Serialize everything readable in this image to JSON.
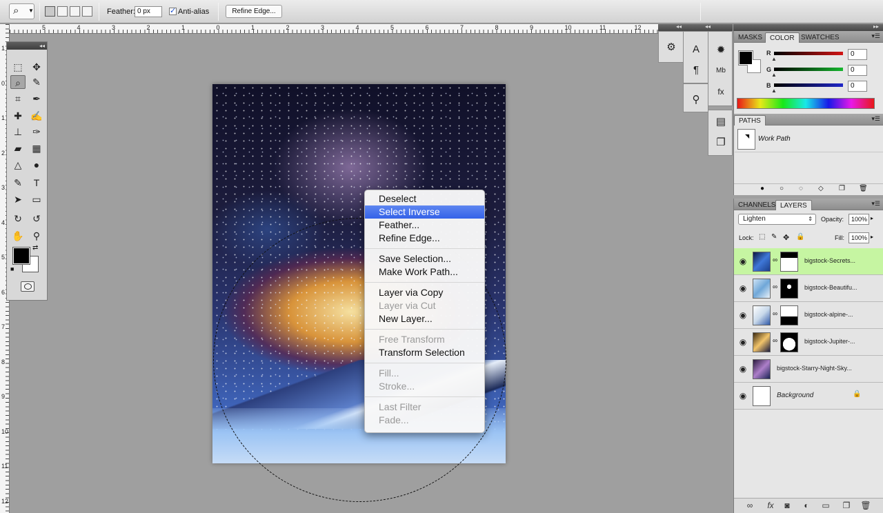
{
  "options_bar": {
    "tool_icon": "lasso-icon",
    "feather_label": "Feather:",
    "feather_value": "0 px",
    "anti_alias_label": "Anti-alias",
    "anti_alias_checked": true,
    "refine_edge_button": "Refine Edge..."
  },
  "ruler": {
    "horizontal": [
      "5",
      "4",
      "3",
      "2",
      "1",
      "0",
      "1",
      "2",
      "3",
      "4",
      "5",
      "6",
      "7",
      "8",
      "9",
      "10",
      "11",
      "12"
    ],
    "vertical": [
      "1",
      "0",
      "1",
      "2",
      "3",
      "4",
      "5",
      "6",
      "7",
      "8",
      "9",
      "10",
      "11",
      "12"
    ]
  },
  "tools_panel": {
    "collapse_glyph": "◂◂",
    "tools": [
      "marquee-icon",
      "move-icon",
      "lasso-icon",
      "quick-selection-icon",
      "crop-icon",
      "eyedropper-icon",
      "healing-brush-icon",
      "brush-icon",
      "clone-stamp-icon",
      "history-brush-icon",
      "eraser-icon",
      "gradient-icon",
      "blur-icon",
      "dodge-icon",
      "pen-icon",
      "type-icon",
      "path-selection-icon",
      "rectangle-icon",
      "3d-rotate-icon",
      "3d-orbit-icon",
      "hand-icon",
      "zoom-icon"
    ],
    "quick_mask_icon": "quick-mask-icon"
  },
  "context_menu": {
    "items": [
      {
        "label": "Deselect",
        "enabled": true
      },
      {
        "label": "Select Inverse",
        "enabled": true,
        "highlighted": true
      },
      {
        "label": "Feather...",
        "enabled": true
      },
      {
        "label": "Refine Edge...",
        "enabled": true
      },
      {
        "sep": true
      },
      {
        "label": "Save Selection...",
        "enabled": true
      },
      {
        "label": "Make Work Path...",
        "enabled": true
      },
      {
        "sep": true
      },
      {
        "label": "Layer via Copy",
        "enabled": true
      },
      {
        "label": "Layer via Cut",
        "enabled": false
      },
      {
        "label": "New Layer...",
        "enabled": true
      },
      {
        "sep": true
      },
      {
        "label": "Free Transform",
        "enabled": false
      },
      {
        "label": "Transform Selection",
        "enabled": true
      },
      {
        "sep": true
      },
      {
        "label": "Fill...",
        "enabled": false
      },
      {
        "label": "Stroke...",
        "enabled": false
      },
      {
        "sep": true
      },
      {
        "label": "Last Filter",
        "enabled": false
      },
      {
        "label": "Fade...",
        "enabled": false
      }
    ]
  },
  "dock_icons": {
    "collapse_glyph": "◂◂",
    "group1": [
      "tool-presets-icon"
    ],
    "group2": [
      "character-icon",
      "paragraph-icon"
    ],
    "group3": [
      "clone-source-icon"
    ],
    "group4": [
      "brush-presets-icon",
      "mini-bridge-icon",
      "styles-icon"
    ],
    "group5": [
      "notes-icon",
      "layer-comps-icon"
    ]
  },
  "color_panel": {
    "tabs": [
      "MASKS",
      "COLOR",
      "SWATCHES"
    ],
    "active_tab": "COLOR",
    "channels": [
      {
        "name": "R",
        "value": "0",
        "color": "#d21414"
      },
      {
        "name": "G",
        "value": "0",
        "color": "#16b62e"
      },
      {
        "name": "B",
        "value": "0",
        "color": "#1f26c8"
      }
    ]
  },
  "paths_panel": {
    "tabs": [
      "PATHS"
    ],
    "items": [
      {
        "name": "Work Path"
      }
    ]
  },
  "layers_panel": {
    "tabs": [
      "CHANNELS",
      "LAYERS"
    ],
    "active_tab": "LAYERS",
    "blend_mode": "Lighten",
    "opacity_label": "Opacity:",
    "opacity_value": "100%",
    "lock_label": "Lock:",
    "fill_label": "Fill:",
    "fill_value": "100%",
    "layers": [
      {
        "name": "bigstock-Secrets...",
        "selected": true,
        "has_mask": true
      },
      {
        "name": "bigstock-Beautifu...",
        "selected": false,
        "has_mask": true
      },
      {
        "name": "bigstock-alpine-...",
        "selected": false,
        "has_mask": true
      },
      {
        "name": "bigstock-Jupiter-...",
        "selected": false,
        "has_mask": true
      },
      {
        "name": "bigstock-Starry-Night-Sky...",
        "selected": false,
        "has_mask": false
      },
      {
        "name": "Background",
        "selected": false,
        "has_mask": false,
        "locked": true
      }
    ],
    "footer_icons": [
      "link-icon",
      "fx-icon",
      "add-mask-icon",
      "adjustment-icon",
      "group-icon",
      "new-layer-icon",
      "delete-icon"
    ]
  },
  "collapse": {
    "panels_glyph": "▸▸"
  }
}
